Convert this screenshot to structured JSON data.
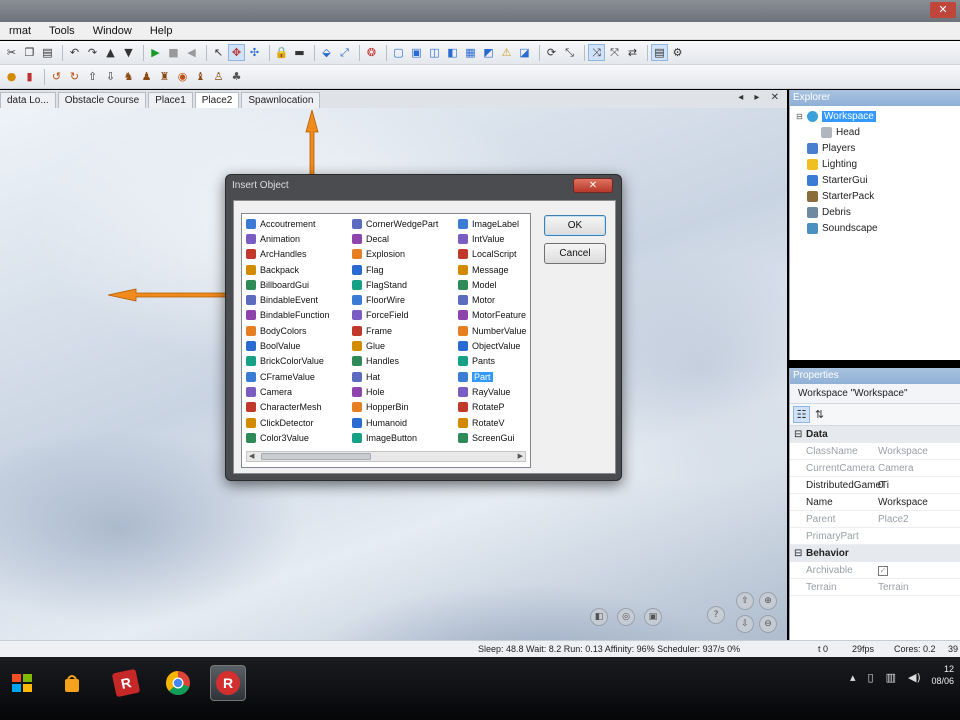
{
  "menu": [
    "rmat",
    "Tools",
    "Window",
    "Help"
  ],
  "tabs": [
    "data Lo...",
    "Obstacle Course",
    "Place1",
    "Place2",
    "Spawnlocation"
  ],
  "tab_controls": "◂ ▸ ✕",
  "dialog": {
    "title": "Insert Object",
    "ok_label": "OK",
    "cancel_label": "Cancel",
    "columns": [
      [
        "Accoutrement",
        "Animation",
        "ArcHandles",
        "Backpack",
        "BillboardGui",
        "BindableEvent",
        "BindableFunction",
        "BodyColors",
        "BoolValue",
        "BrickColorValue",
        "CFrameValue",
        "Camera",
        "CharacterMesh",
        "ClickDetector",
        "Color3Value"
      ],
      [
        "CornerWedgePart",
        "Decal",
        "Explosion",
        "Flag",
        "FlagStand",
        "FloorWire",
        "ForceField",
        "Frame",
        "Glue",
        "Handles",
        "Hat",
        "Hole",
        "HopperBin",
        "Humanoid",
        "ImageButton"
      ],
      [
        "ImageLabel",
        "IntValue",
        "LocalScript",
        "Message",
        "Model",
        "Motor",
        "MotorFeature",
        "NumberValue",
        "ObjectValue",
        "Pants",
        "Part",
        "RayValue",
        "RotateP",
        "RotateV",
        "ScreenGui"
      ]
    ],
    "selected": "Part"
  },
  "explorer": {
    "title": "Explorer",
    "items": [
      {
        "label": "Workspace",
        "level": 0,
        "selected": true,
        "icon": "globe-icon",
        "expander": "⊟"
      },
      {
        "label": "Head",
        "level": 1,
        "selected": false,
        "icon": "part-icon",
        "expander": ""
      },
      {
        "label": "Players",
        "level": 0,
        "selected": false,
        "icon": "players-icon",
        "expander": ""
      },
      {
        "label": "Lighting",
        "level": 0,
        "selected": false,
        "icon": "lighting-icon",
        "expander": ""
      },
      {
        "label": "StarterGui",
        "level": 0,
        "selected": false,
        "icon": "gui-icon",
        "expander": ""
      },
      {
        "label": "StarterPack",
        "level": 0,
        "selected": false,
        "icon": "pack-icon",
        "expander": ""
      },
      {
        "label": "Debris",
        "level": 0,
        "selected": false,
        "icon": "debris-icon",
        "expander": ""
      },
      {
        "label": "Soundscape",
        "level": 0,
        "selected": false,
        "icon": "sound-icon",
        "expander": ""
      }
    ]
  },
  "properties": {
    "title": "Properties",
    "object": "Workspace \"Workspace\"",
    "categories": [
      {
        "name": "Data",
        "marker": "⊟",
        "rows": [
          {
            "key": "ClassName",
            "value": "Workspace",
            "readonly": true
          },
          {
            "key": "CurrentCamera",
            "value": "Camera",
            "readonly": true
          },
          {
            "key": "DistributedGameTi",
            "value": "0",
            "readonly": false
          },
          {
            "key": "Name",
            "value": "Workspace",
            "readonly": false
          },
          {
            "key": "Parent",
            "value": "Place2",
            "readonly": true
          },
          {
            "key": "PrimaryPart",
            "value": "",
            "readonly": true
          }
        ]
      },
      {
        "name": "Behavior",
        "marker": "⊟",
        "rows": [
          {
            "key": "Archivable",
            "value": "✓",
            "readonly": true
          },
          {
            "key": "Terrain",
            "value": "Terrain",
            "readonly": true
          }
        ]
      }
    ]
  },
  "status": {
    "stats": "Sleep: 48.8 Wait: 8.2 Run: 0.13 Affinity: 96% Scheduler: 937/s 0%",
    "t": "t 0",
    "fps": "29fps",
    "cores": "Cores: 0.2",
    "extra": "39"
  },
  "taskbar": {
    "clock_line1": "12",
    "clock_line2": "08/06"
  },
  "colors": {
    "accent": "#3399ff",
    "handle": "#f08a1c",
    "panel_header": "#8fb0d6"
  }
}
